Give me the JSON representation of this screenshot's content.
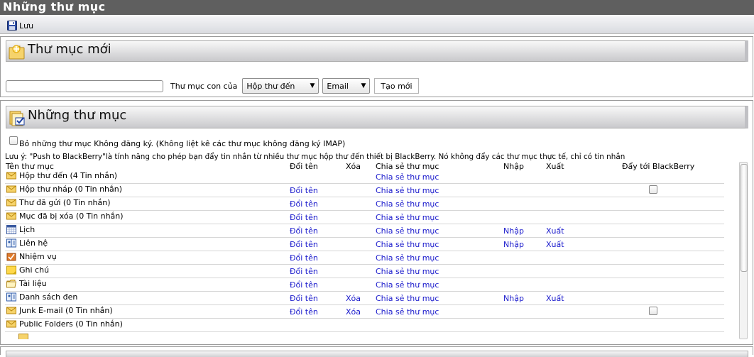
{
  "window": {
    "title": "Những thư mục"
  },
  "toolbar": {
    "save_label": "Lưu"
  },
  "new_folder": {
    "heading": "Thư mục mới",
    "name_value": "",
    "parent_label": "Thư mục con của",
    "parent_select": "Hộp thư đến",
    "type_select": "Email",
    "create_label": "Tạo mới"
  },
  "folders": {
    "heading": "Những thư mục",
    "unsubscribed_label": "Bỏ những thư mục Không đăng ký. (Không liệt kê các thư mục không đăng ký IMAP)",
    "note": "Lưu ý: \"Push to BlackBerry\"là tính năng cho phép bạn đẩy tin nhắn từ nhiều thư mục hộp thư đến thiết bị BlackBerry. Nó không đẩy các thư mục thực tế, chỉ có tin nhắn",
    "columns": {
      "name": "Tên thư mục",
      "rename": "Đổi tên",
      "delete": "Xóa",
      "share": "Chia sẻ thư mục",
      "import": "Nhập",
      "export": "Xuất",
      "push": "Đẩy tới BlackBerry"
    },
    "rows": [
      {
        "icon": "envelope-icon",
        "name": "Hộp thư đến (4 Tin nhắn)",
        "rename": "",
        "delete": "",
        "share": "Chia sẻ thư mục",
        "import": "",
        "export": "",
        "push": false
      },
      {
        "icon": "envelope-icon",
        "name": "Hộp thư nháp (0 Tin nhắn)",
        "rename": "Đổi tên",
        "delete": "",
        "share": "Chia sẻ thư mục",
        "import": "",
        "export": "",
        "push": true
      },
      {
        "icon": "envelope-icon",
        "name": "Thư đã gửi (0 Tin nhắn)",
        "rename": "Đổi tên",
        "delete": "",
        "share": "Chia sẻ thư mục",
        "import": "",
        "export": "",
        "push": false
      },
      {
        "icon": "envelope-icon",
        "name": "Mục đã bị xóa (0 Tin nhắn)",
        "rename": "Đổi tên",
        "delete": "",
        "share": "Chia sẻ thư mục",
        "import": "",
        "export": "",
        "push": false
      },
      {
        "icon": "calendar-icon",
        "name": "Lịch",
        "rename": "Đổi tên",
        "delete": "",
        "share": "Chia sẻ thư mục",
        "import": "Nhập",
        "export": "Xuất",
        "push": false
      },
      {
        "icon": "address-book-icon",
        "name": "Liên hệ",
        "rename": "Đổi tên",
        "delete": "",
        "share": "Chia sẻ thư mục",
        "import": "Nhập",
        "export": "Xuất",
        "push": false
      },
      {
        "icon": "task-icon",
        "name": "Nhiệm vụ",
        "rename": "Đổi tên",
        "delete": "",
        "share": "Chia sẻ thư mục",
        "import": "",
        "export": "",
        "push": false
      },
      {
        "icon": "note-icon",
        "name": "Ghi chú",
        "rename": "Đổi tên",
        "delete": "",
        "share": "Chia sẻ thư mục",
        "import": "",
        "export": "",
        "push": false
      },
      {
        "icon": "folder-icon",
        "name": "Tài liệu",
        "rename": "Đổi tên",
        "delete": "",
        "share": "Chia sẻ thư mục",
        "import": "",
        "export": "",
        "push": false
      },
      {
        "icon": "address-book-icon",
        "name": "Danh sách đen",
        "rename": "Đổi tên",
        "delete": "Xóa",
        "share": "Chia sẻ thư mục",
        "import": "Nhập",
        "export": "Xuất",
        "push": false
      },
      {
        "icon": "envelope-icon",
        "name": "Junk E-mail (0 Tin nhắn)",
        "rename": "Đổi tên",
        "delete": "Xóa",
        "share": "Chia sẻ thư mục",
        "import": "",
        "export": "",
        "push": true
      },
      {
        "icon": "envelope-icon",
        "name": "Public Folders (0 Tin nhắn)",
        "rename": "",
        "delete": "",
        "share": "",
        "import": "",
        "export": "",
        "push": false
      }
    ]
  }
}
